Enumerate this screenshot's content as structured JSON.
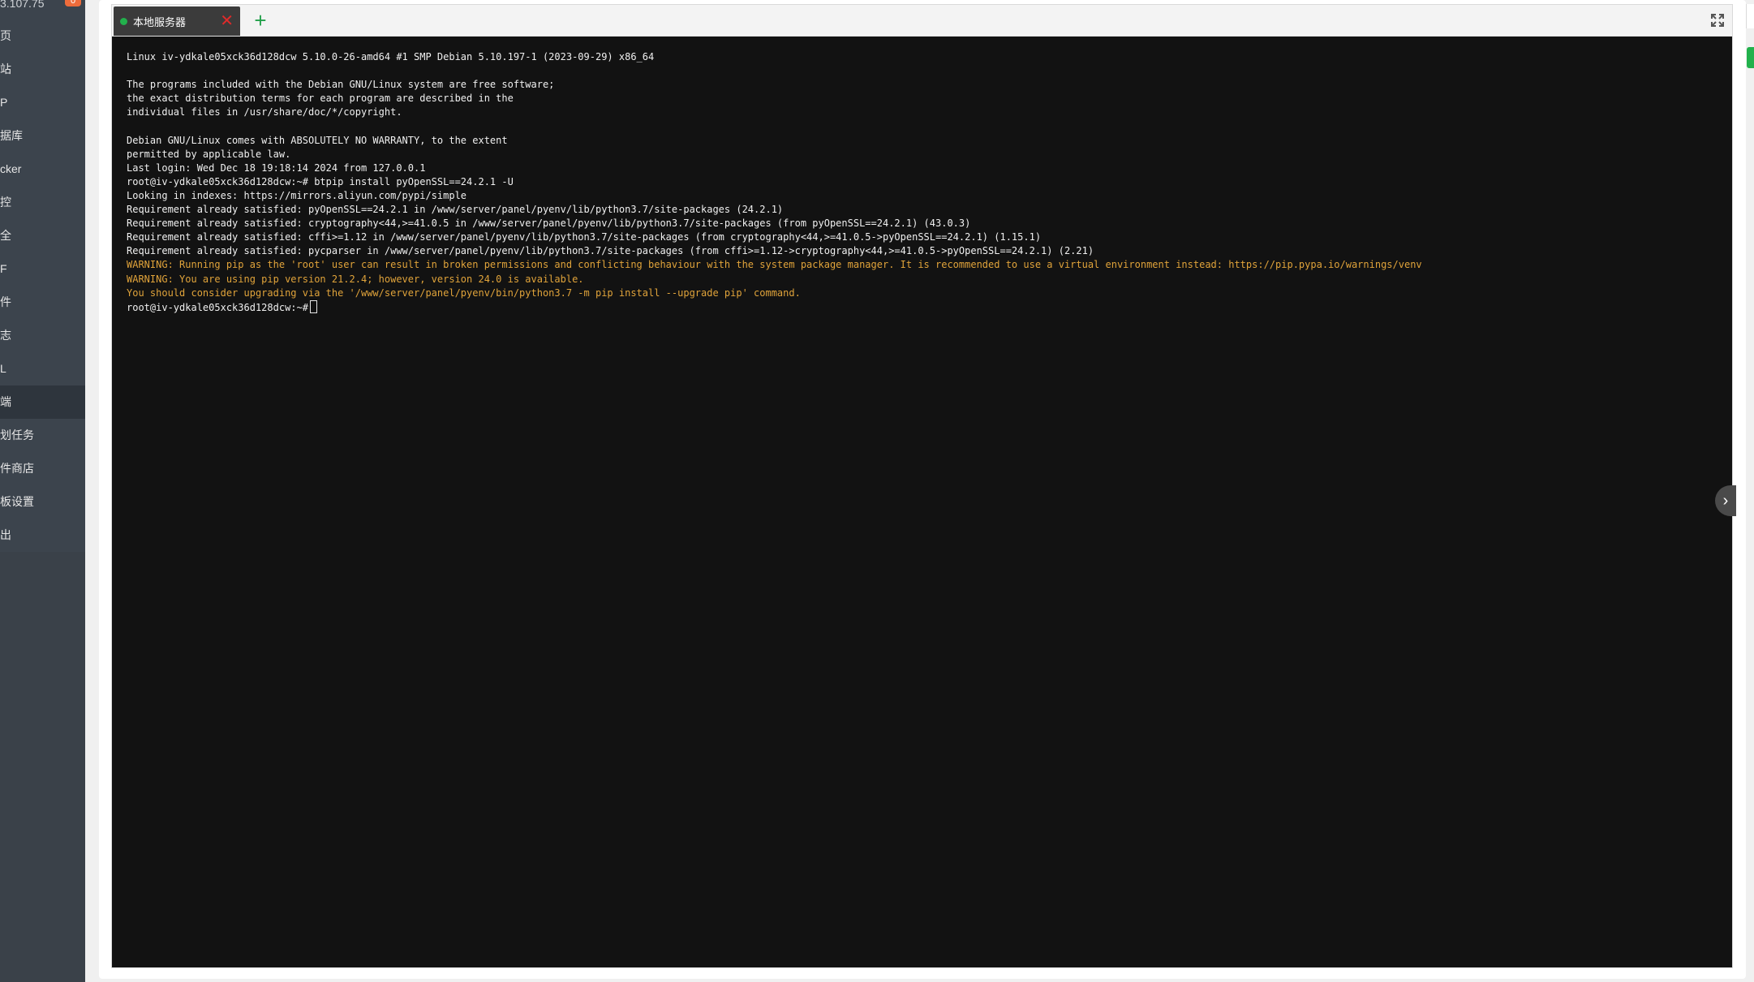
{
  "sidebar": {
    "ip": "3.107.75",
    "badge": "0",
    "items": [
      {
        "label": "页"
      },
      {
        "label": "站"
      },
      {
        "label": "P"
      },
      {
        "label": "据库"
      },
      {
        "label": "cker"
      },
      {
        "label": "控"
      },
      {
        "label": "全"
      },
      {
        "label": "F"
      },
      {
        "label": "件"
      },
      {
        "label": "志"
      },
      {
        "label": "L"
      },
      {
        "label": "端"
      },
      {
        "label": "划任务"
      },
      {
        "label": "件商店"
      },
      {
        "label": "板设置"
      },
      {
        "label": "出"
      }
    ]
  },
  "terminal": {
    "tab_label": "本地服务器",
    "tab_close": "✕",
    "add_tab": "+",
    "lines": [
      {
        "text": "Linux iv-ydkale05xck36d128dcw 5.10.0-26-amd64 #1 SMP Debian 5.10.197-1 (2023-09-29) x86_64",
        "warn": false
      },
      {
        "text": "",
        "warn": false
      },
      {
        "text": "The programs included with the Debian GNU/Linux system are free software;",
        "warn": false
      },
      {
        "text": "the exact distribution terms for each program are described in the",
        "warn": false
      },
      {
        "text": "individual files in /usr/share/doc/*/copyright.",
        "warn": false
      },
      {
        "text": "",
        "warn": false
      },
      {
        "text": "Debian GNU/Linux comes with ABSOLUTELY NO WARRANTY, to the extent",
        "warn": false
      },
      {
        "text": "permitted by applicable law.",
        "warn": false
      },
      {
        "text": "Last login: Wed Dec 18 19:18:14 2024 from 127.0.0.1",
        "warn": false
      },
      {
        "text": "root@iv-ydkale05xck36d128dcw:~# btpip install pyOpenSSL==24.2.1 -U",
        "warn": false
      },
      {
        "text": "Looking in indexes: https://mirrors.aliyun.com/pypi/simple",
        "warn": false
      },
      {
        "text": "Requirement already satisfied: pyOpenSSL==24.2.1 in /www/server/panel/pyenv/lib/python3.7/site-packages (24.2.1)",
        "warn": false
      },
      {
        "text": "Requirement already satisfied: cryptography<44,>=41.0.5 in /www/server/panel/pyenv/lib/python3.7/site-packages (from pyOpenSSL==24.2.1) (43.0.3)",
        "warn": false
      },
      {
        "text": "Requirement already satisfied: cffi>=1.12 in /www/server/panel/pyenv/lib/python3.7/site-packages (from cryptography<44,>=41.0.5->pyOpenSSL==24.2.1) (1.15.1)",
        "warn": false
      },
      {
        "text": "Requirement already satisfied: pycparser in /www/server/panel/pyenv/lib/python3.7/site-packages (from cffi>=1.12->cryptography<44,>=41.0.5->pyOpenSSL==24.2.1) (2.21)",
        "warn": false
      },
      {
        "text": "WARNING: Running pip as the 'root' user can result in broken permissions and conflicting behaviour with the system package manager. It is recommended to use a virtual environment instead: https://pip.pypa.io/warnings/venv",
        "warn": true
      },
      {
        "text": "WARNING: You are using pip version 21.2.4; however, version 24.0 is available.",
        "warn": true
      },
      {
        "text": "You should consider upgrading via the '/www/server/panel/pyenv/bin/python3.7 -m pip install --upgrade pip' command.",
        "warn": true
      }
    ],
    "prompt": "root@iv-ydkale05xck36d128dcw:~#"
  },
  "colors": {
    "sidebar_bg": "#3c444d",
    "terminal_bg": "#121212",
    "warning_text": "#e0a33a",
    "accent_green": "#22b14c",
    "close_red": "#e02a2a"
  },
  "icons": {
    "fullscreen": "fullscreen-icon",
    "collapse": "chevron-right-icon",
    "status": "status-dot-icon"
  }
}
